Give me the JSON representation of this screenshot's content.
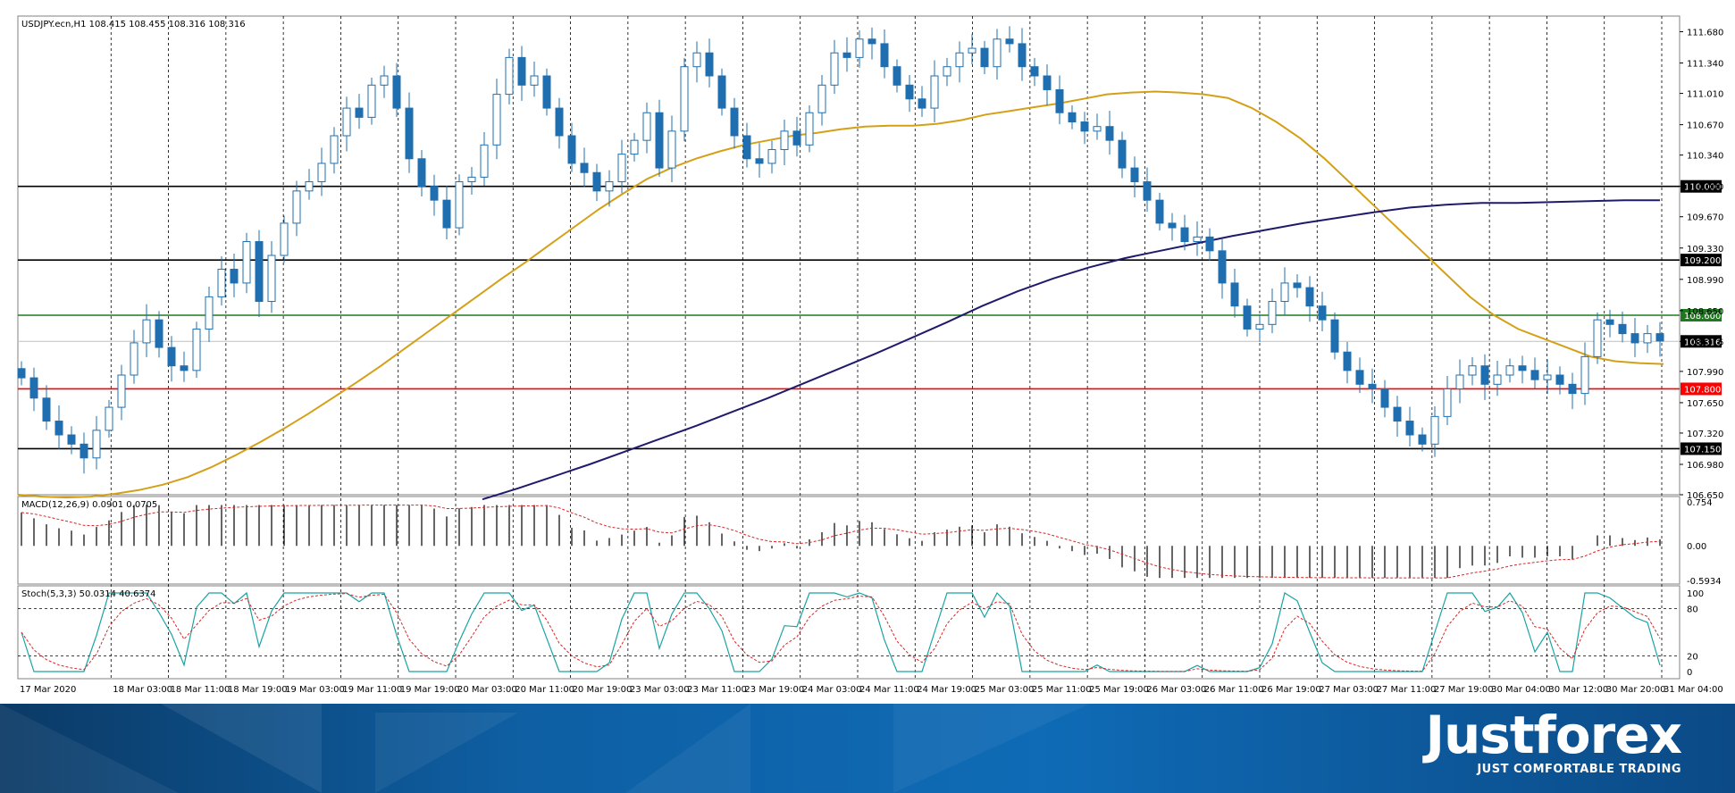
{
  "header": {
    "symbol_info": "USDJPY.ecn,H1  108.415 108.455 108.316 108.316",
    "macd_label": "MACD(12,26,9) 0.0901 0.0705",
    "stoch_label": "Stoch(5,3,3) 50.0314 40.6374"
  },
  "brand": {
    "logo_text": "Justforex",
    "tagline": "JUST COMFORTABLE TRADING"
  },
  "colors": {
    "bull_candle": "#ffffff",
    "bear_candle": "#1f6fb0",
    "ma_fast": "#d4a017",
    "ma_slow": "#1f1a6b",
    "macd_signal": "#d62728",
    "stoch_main": "#1aa3a3",
    "stoch_signal": "#d62728",
    "level_black": "#000000",
    "level_green": "#1f7a1f",
    "level_red": "#ff0000",
    "current_price_tag": "#000000"
  },
  "chart_data": {
    "type": "candlestick",
    "symbol": "USDJPY.ecn",
    "timeframe": "H1",
    "ylim": [
      106.65,
      111.85
    ],
    "price_ticks": [
      "111.680",
      "111.340",
      "111.010",
      "110.670",
      "110.340",
      "110.000",
      "109.670",
      "109.330",
      "108.990",
      "108.650",
      "108.316",
      "107.990",
      "107.650",
      "107.320",
      "106.980",
      "106.650"
    ],
    "x_labels": [
      "17 Mar 2020",
      "18 Mar 03:00",
      "18 Mar 11:00",
      "18 Mar 19:00",
      "19 Mar 03:00",
      "19 Mar 11:00",
      "19 Mar 19:00",
      "20 Mar 03:00",
      "20 Mar 11:00",
      "20 Mar 19:00",
      "23 Mar 03:00",
      "23 Mar 11:00",
      "23 Mar 19:00",
      "24 Mar 03:00",
      "24 Mar 11:00",
      "24 Mar 19:00",
      "25 Mar 03:00",
      "25 Mar 11:00",
      "25 Mar 19:00",
      "26 Mar 03:00",
      "26 Mar 11:00",
      "26 Mar 19:00",
      "27 Mar 03:00",
      "27 Mar 11:00",
      "27 Mar 19:00",
      "30 Mar 04:00",
      "30 Mar 12:00",
      "30 Mar 20:00",
      "31 Mar 04:00"
    ],
    "levels": [
      {
        "value": 110.0,
        "label": "110.000",
        "color": "#000000"
      },
      {
        "value": 109.2,
        "label": "109.200",
        "color": "#000000"
      },
      {
        "value": 108.6,
        "label": "108.600",
        "color": "#1f7a1f"
      },
      {
        "value": 107.8,
        "label": "107.800",
        "color": "#ff0000"
      },
      {
        "value": 107.15,
        "label": "107.150",
        "color": "#000000"
      }
    ],
    "current_price": 108.316,
    "current_price_label": "108.316",
    "closes": [
      107.92,
      107.7,
      107.45,
      107.3,
      107.2,
      107.05,
      107.35,
      107.6,
      107.95,
      108.3,
      108.55,
      108.25,
      108.05,
      108.0,
      108.45,
      108.8,
      109.1,
      108.95,
      109.4,
      108.75,
      109.25,
      109.6,
      109.95,
      110.05,
      110.25,
      110.55,
      110.85,
      110.75,
      111.1,
      111.2,
      110.85,
      110.3,
      110.0,
      109.85,
      109.55,
      110.05,
      110.1,
      110.45,
      111.0,
      111.4,
      111.1,
      111.2,
      110.85,
      110.55,
      110.25,
      110.15,
      109.95,
      110.05,
      110.35,
      110.5,
      110.8,
      110.2,
      110.6,
      111.3,
      111.45,
      111.2,
      110.85,
      110.55,
      110.3,
      110.25,
      110.4,
      110.6,
      110.45,
      110.8,
      111.1,
      111.45,
      111.4,
      111.6,
      111.55,
      111.3,
      111.1,
      110.95,
      110.85,
      111.2,
      111.3,
      111.45,
      111.5,
      111.3,
      111.6,
      111.55,
      111.3,
      111.2,
      111.05,
      110.8,
      110.7,
      110.6,
      110.65,
      110.5,
      110.2,
      110.05,
      109.85,
      109.6,
      109.55,
      109.4,
      109.45,
      109.3,
      108.95,
      108.7,
      108.45,
      108.5,
      108.75,
      108.95,
      108.9,
      108.7,
      108.55,
      108.2,
      108.0,
      107.85,
      107.8,
      107.6,
      107.45,
      107.3,
      107.2,
      107.5,
      107.8,
      107.95,
      108.05,
      107.85,
      107.95,
      108.05,
      108.0,
      107.9,
      107.95,
      107.85,
      107.75,
      108.15,
      108.55,
      108.5,
      108.4,
      108.3,
      108.4,
      108.32
    ],
    "ma_fast": [
      106.65,
      106.63,
      106.62,
      106.63,
      106.66,
      106.7,
      106.76,
      106.84,
      106.95,
      107.08,
      107.22,
      107.37,
      107.53,
      107.7,
      107.87,
      108.05,
      108.24,
      108.43,
      108.62,
      108.81,
      109.0,
      109.18,
      109.37,
      109.56,
      109.75,
      109.92,
      110.08,
      110.2,
      110.3,
      110.38,
      110.45,
      110.5,
      110.55,
      110.58,
      110.62,
      110.65,
      110.66,
      110.66,
      110.68,
      110.72,
      110.78,
      110.82,
      110.86,
      110.9,
      110.95,
      111.0,
      111.02,
      111.03,
      111.02,
      111.0,
      110.96,
      110.85,
      110.7,
      110.52,
      110.3,
      110.05,
      109.8,
      109.55,
      109.3,
      109.05,
      108.8,
      108.6,
      108.45,
      108.35,
      108.25,
      108.15,
      108.1,
      108.08,
      108.07
    ],
    "ma_slow": [
      106.6,
      106.72,
      106.85,
      106.98,
      107.12,
      107.26,
      107.4,
      107.55,
      107.7,
      107.86,
      108.02,
      108.18,
      108.35,
      108.52,
      108.7,
      108.86,
      109.0,
      109.12,
      109.22,
      109.3,
      109.38,
      109.46,
      109.53,
      109.6,
      109.66,
      109.72,
      109.77,
      109.8,
      109.82,
      109.82,
      109.83,
      109.84,
      109.85,
      109.85
    ],
    "macd_ylim": [
      -0.5934,
      0.754
    ],
    "macd_ticks": [
      "0.754",
      "0.00",
      "-0.5934"
    ],
    "stoch_ticks": [
      "100",
      "80",
      "20",
      "0"
    ]
  }
}
